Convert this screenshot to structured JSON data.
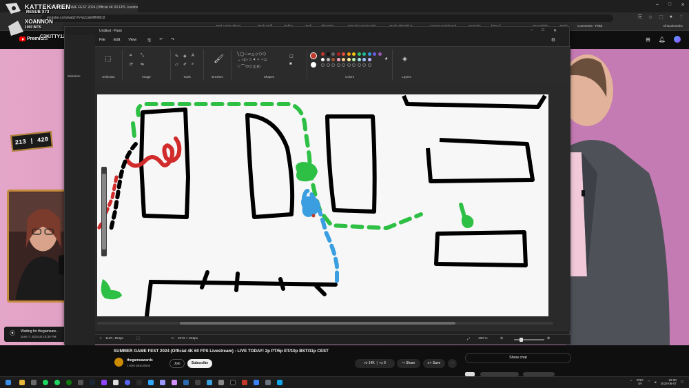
{
  "browser": {
    "tab_title": "(1) SUMMER GAME FEST 2024 (Official 4K 60 FPS Livestream) - LIVE TODAY!",
    "url": "youtube.com/watch?v=pZzsEWNMcI2",
    "bookmarks": [
      "Red x Fate The N",
      "Work Stuff",
      "Hobby",
      "Tech",
      "Shopping",
      "Animal Crossing Dist",
      "Studio PlayOft O",
      "Creator Dashboard",
      "YouTube",
      "https://...",
      "Streamlabs",
      "Twitch",
      "Comments - Fiskit"
    ],
    "all_bookmarks": "All Bookmarks"
  },
  "youtube": {
    "premium_label": "Premium"
  },
  "overlay": {
    "line1": "KATTEKAREN",
    "line2": "RESUB X73",
    "line3": "XOANNON",
    "line4": "1000 BITS",
    "line5": "C3KITTY12",
    "counter": "213 | 420"
  },
  "paint": {
    "window_title": "Untitled - Paint",
    "menu": [
      "File",
      "Edit",
      "View"
    ],
    "ribbon_groups": [
      "Selection",
      "Image",
      "Tools",
      "Brushes",
      "Shapes",
      "Colors",
      "Layers"
    ],
    "status_position": "1187, 454px",
    "status_size": "2072 × 818px",
    "zoom": "100 %",
    "left_label": "Selection",
    "colors": {
      "row1": [
        "#c0392b",
        "#111111",
        "#666666",
        "#b91d1d",
        "#e74c3c",
        "#f39c12",
        "#f1c40f",
        "#2ecc71",
        "#1abc9c",
        "#3498db",
        "#6c5ce7",
        "#9b59b6"
      ],
      "row2": [
        "#ffffff",
        "#bbbbbb",
        "#a0522d",
        "#f8a5c2",
        "#ffd28a",
        "#fff3a0",
        "#b8f0b0",
        "#a0e7e5",
        "#a0c4ff",
        "#c5b3ff"
      ]
    }
  },
  "waiting": {
    "title": "Waiting for thegameaw...",
    "date": "June 7, 2024 at 10:30 PM"
  },
  "video": {
    "title": "SUMMER GAME FEST 2024 (Official 4K 60 FPS Livestream) - LIVE TODAY! 2p PT/5p ET/10p BST/11p CEST",
    "channel": "thegameawards",
    "subscribers": "1.93M subscribers",
    "join": "Join",
    "subscribe": "Subscribe",
    "likes": "14K",
    "dislikes": "0",
    "share": "Share",
    "save": "Save",
    "show_chat": "Show chat"
  },
  "taskbar": {
    "lang": "ENG",
    "region": "SV",
    "time": "22:30",
    "date": "2024-06-07"
  }
}
